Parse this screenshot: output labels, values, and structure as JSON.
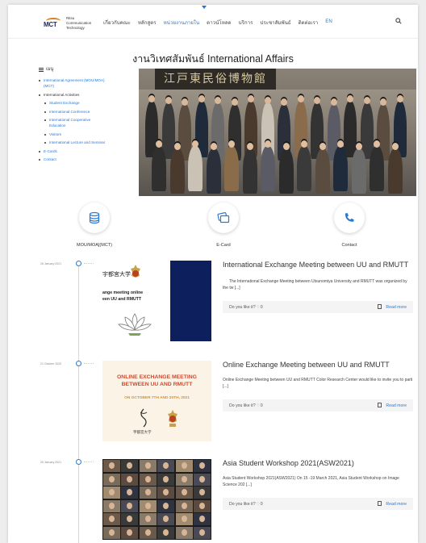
{
  "header": {
    "logo_text": "Ritsu Communication Technology",
    "logo_mark": "MCT",
    "nav": [
      {
        "label": "เกี่ยวกับคณะ",
        "active": false
      },
      {
        "label": "หลักสูตร",
        "active": false
      },
      {
        "label": "หน่วยงานภายใน",
        "active": true
      },
      {
        "label": "ดาวน์โหลด",
        "active": false
      },
      {
        "label": "บริการ",
        "active": false
      },
      {
        "label": "ประชาสัมพันธ์",
        "active": false
      }
    ],
    "contact": "ติดต่อเรา",
    "lang": "EN"
  },
  "page_title": "งานวิเทศสัมพันธ์ International Affairs",
  "menu": {
    "heading": "เมนู",
    "items": [
      {
        "label": "International Agreement (MOU/MOA)",
        "level": 0
      },
      {
        "label": "(MCT)",
        "level": 0,
        "continuation": true
      },
      {
        "label": "International Activities",
        "level": 0,
        "plain": true
      },
      {
        "label": "Student Exchange",
        "level": 1
      },
      {
        "label": "International Conference",
        "level": 1
      },
      {
        "label": "International Cooperative",
        "level": 1
      },
      {
        "label": "Education",
        "level": 1,
        "continuation": true
      },
      {
        "label": "Visitors",
        "level": 1
      },
      {
        "label": "International Lecture and Seminar",
        "level": 1
      },
      {
        "label": "E-Cards",
        "level": 0
      },
      {
        "label": "Contact",
        "level": 0
      }
    ]
  },
  "hero": {
    "banner_text": "江戸東民俗博物館"
  },
  "quick_links": [
    {
      "label": "MOU/MOA](MCT)",
      "icon": "database-icon"
    },
    {
      "label": "E-Card",
      "icon": "card-icon"
    },
    {
      "label": "Contact",
      "icon": "phone-icon"
    }
  ],
  "posts": [
    {
      "date": "26 January 2021",
      "title": "International Exchange Meeting between UU and RMUTT",
      "excerpt": "The International Exchange Meeting between Utsunomiya University and RMUTT was organized by the tw [...]",
      "like": "Do you like it?",
      "like_count": "0",
      "read_more": "Read more",
      "thumb_text": "宇都宮大学",
      "thumb_caption_1": "ange meeting online",
      "thumb_caption_2": "een UU and RMUTT"
    },
    {
      "date": "21 October 2020",
      "title": "Online Exchange Meeting between UU and RMUTT",
      "excerpt": "Online Exchange Meeting between UU and RMUTT Color Research Center would like to invite you to parti [...]",
      "like": "Do you like it?",
      "like_count": "0",
      "read_more": "Read more",
      "thumb_line_1": "ONLINE EXCHANGE MEETING",
      "thumb_line_2": "BETWEEN UU AND RMUTT",
      "thumb_line_3": "ON OCTOBER 7TH AND 20TH, 2021",
      "thumb_text": "宇都宮大学"
    },
    {
      "date": "26 January 2021",
      "title": "Asia Student Workshop 2021(ASW2021)",
      "excerpt": "Asia Student Workshop 2021(ASW2021) On 15 -19 March 2021, Asia Student Workshop on Image Science 202 [...]",
      "like": "Do you like it?",
      "like_count": "0",
      "read_more": "Read more"
    }
  ],
  "colors": {
    "accent": "#2a7ad5",
    "navy": "#0d1f5c",
    "orange": "#e07a1a"
  }
}
